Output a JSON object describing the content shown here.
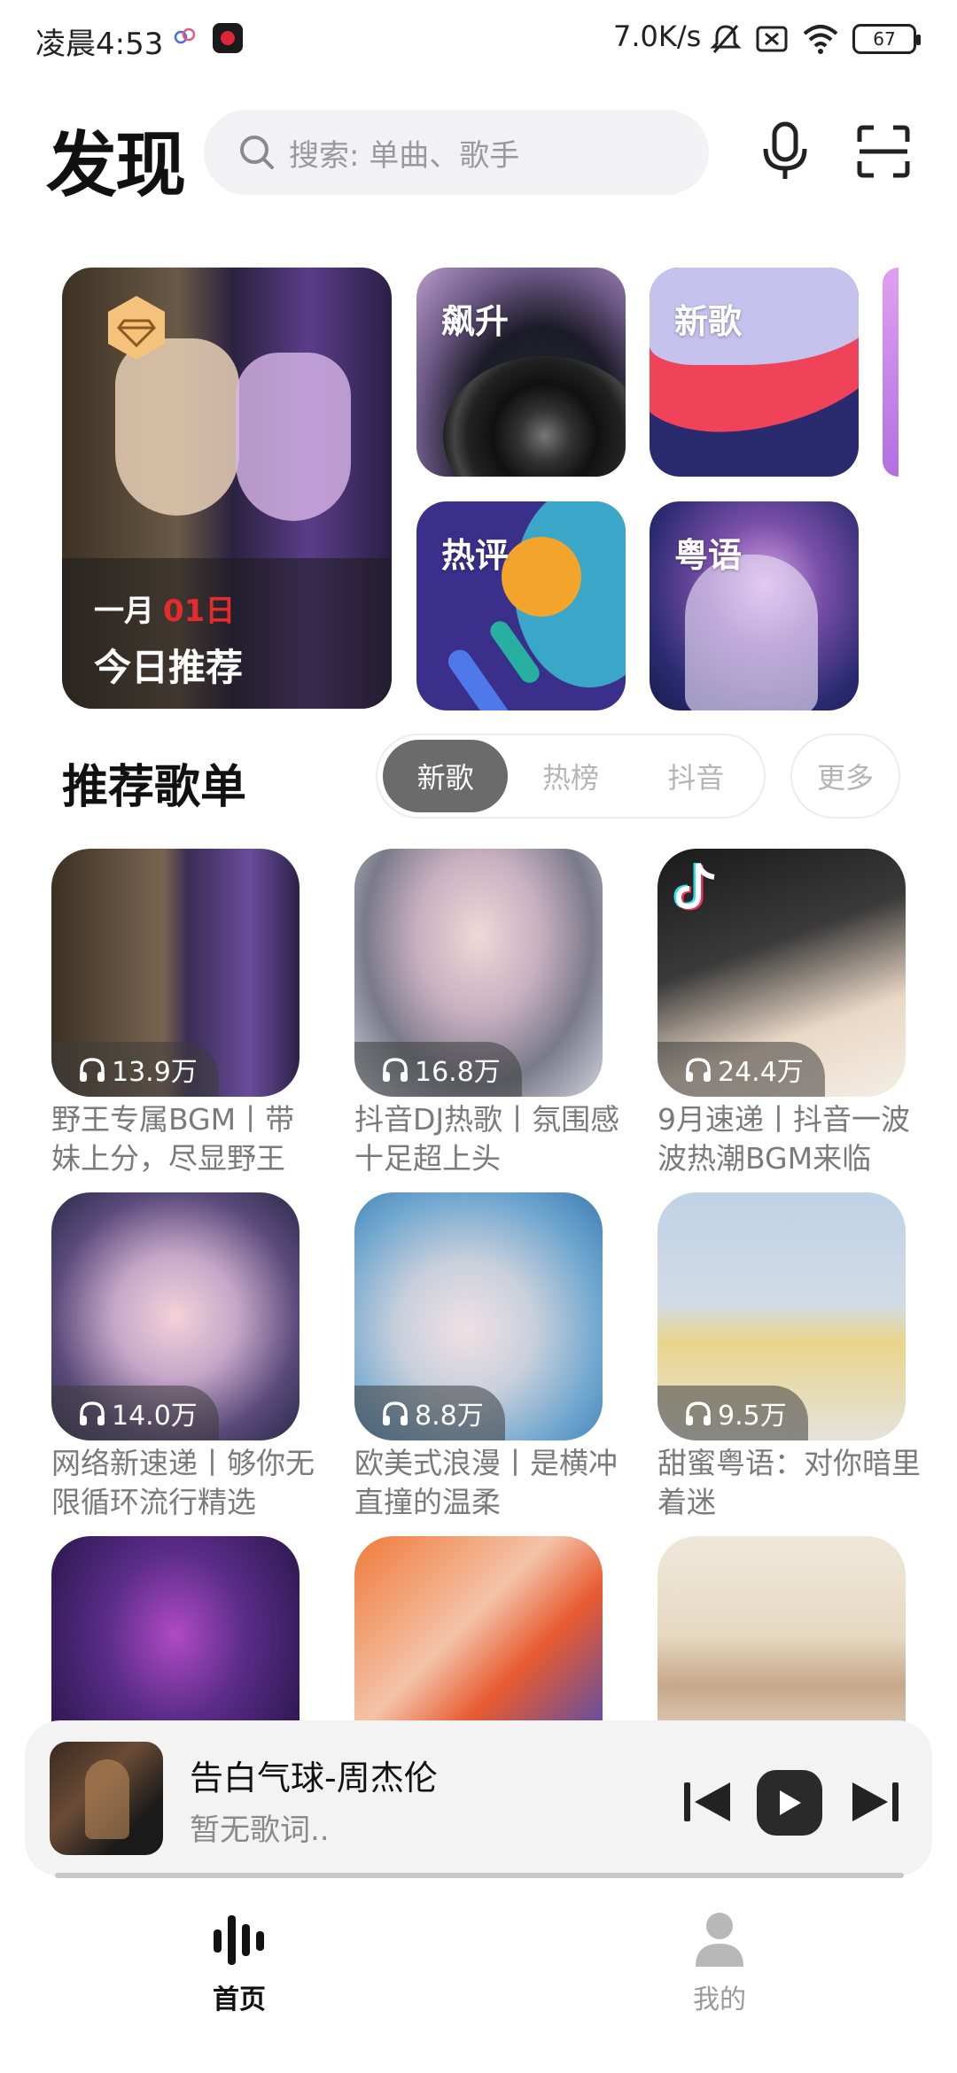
{
  "status_bar": {
    "time": "凌晨4:53",
    "net_speed": "7.0K/s",
    "battery": "67"
  },
  "header": {
    "title": "发现",
    "search_placeholder": "搜索: 单曲、歌手"
  },
  "hero": {
    "date_month": "一月",
    "date_day": "01日",
    "label": "今日推荐",
    "tiles": [
      "飙升",
      "新歌",
      "热评",
      "粤语"
    ]
  },
  "section": {
    "title": "推荐歌单",
    "tabs": [
      "新歌",
      "热榜",
      "抖音"
    ],
    "active_tab": "新歌",
    "more": "更多"
  },
  "playlists": [
    {
      "plays": "13.9万",
      "title": "野王专属BGM丨带妹上分，尽显野王"
    },
    {
      "plays": "16.8万",
      "title": "抖音DJ热歌丨氛围感十足超上头"
    },
    {
      "plays": "24.4万",
      "title": "9月速递丨抖音一波波热潮BGM来临"
    },
    {
      "plays": "14.0万",
      "title": "网络新速递丨够你无限循环流行精选"
    },
    {
      "plays": "8.8万",
      "title": "欧美式浪漫丨是横冲直撞的温柔"
    },
    {
      "plays": "9.5万",
      "title": "甜蜜粤语：对你暗里着迷"
    },
    {
      "plays": "",
      "title": ""
    },
    {
      "plays": "",
      "title": ""
    },
    {
      "plays": "",
      "title": ""
    }
  ],
  "player": {
    "title": "告白气球-周杰伦",
    "subtitle": "暂无歌词.."
  },
  "nav": {
    "home": "首页",
    "me": "我的"
  }
}
